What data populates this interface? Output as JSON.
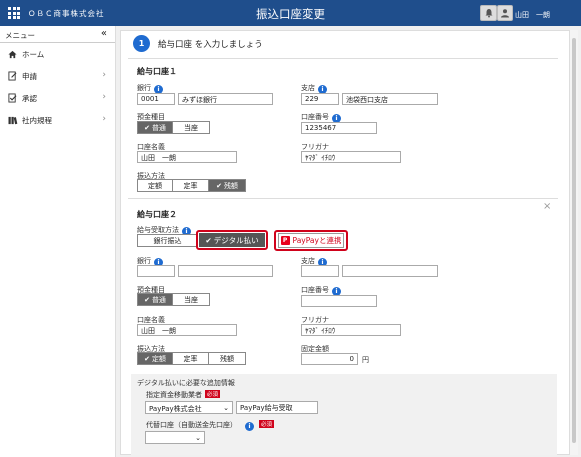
{
  "topbar": {
    "company": "ＯＢＣ商事株式会社",
    "title": "振込口座変更",
    "username": "山田　一朗"
  },
  "sidebar": {
    "header": "メニュー",
    "collapse": "«",
    "items": [
      {
        "label": "ホーム",
        "icon": "home-icon",
        "chevron": false
      },
      {
        "label": "申請",
        "icon": "application-icon",
        "chevron": true
      },
      {
        "label": "承認",
        "icon": "approval-icon",
        "chevron": true
      },
      {
        "label": "社内規程",
        "icon": "books-icon",
        "chevron": true
      }
    ]
  },
  "step": {
    "number": "1",
    "title": "給与口座 を入力しましょう"
  },
  "account1": {
    "title": "給与口座１",
    "bank_label": "銀行",
    "bank_code": "0001",
    "bank_name": "みずほ銀行",
    "branch_label": "支店",
    "branch_code": "229",
    "branch_name": "池袋西口支店",
    "type_label": "預金種目",
    "type_options": [
      "普通",
      "当座"
    ],
    "type_selected": "普通",
    "number_label": "口座番号",
    "number_value": "1235467",
    "holder_label": "口座名義",
    "holder_value": "山田　一朗",
    "kana_label": "フリガナ",
    "kana_value": "ﾔﾏﾀﾞ ｲﾁﾛｳ",
    "method_label": "振込方法",
    "method_options": [
      "定額",
      "定率",
      "残額"
    ],
    "method_selected": "残額"
  },
  "account2": {
    "title": "給与口座２",
    "close": "×",
    "receive_label": "給与受取方法",
    "receive_bank": "銀行振込",
    "receive_digital": "デジタル払い",
    "paypay_button": "PayPayと連携",
    "paypay_logo": "P",
    "bank_label": "銀行",
    "bank_code": "",
    "bank_name": "",
    "branch_label": "支店",
    "branch_code": "",
    "branch_name": "",
    "type_label": "預金種目",
    "type_options": [
      "普通",
      "当座"
    ],
    "type_selected": "普通",
    "number_label": "口座番号",
    "number_value": "",
    "holder_label": "口座名義",
    "holder_value": "山田　一朗",
    "kana_label": "フリガナ",
    "kana_value": "ﾔﾏﾀﾞ ｲﾁﾛｳ",
    "method_label": "振込方法",
    "method_options": [
      "定額",
      "定率",
      "残額"
    ],
    "method_selected": "定額",
    "fixed_label": "固定金額",
    "fixed_value": "0",
    "fixed_unit": "円"
  },
  "digital": {
    "title": "デジタル払いに必要な追加情報",
    "provider_label": "指定資金移動業者",
    "required": "必須",
    "provider_value": "PayPay株式会社",
    "provider_name": "PayPay給与受取",
    "backup_label": "代替口座（自動送金先口座）",
    "backup_value": ""
  },
  "colors": {
    "header": "#1f4e8c",
    "accent": "#1f6bd0",
    "highlight": "#d0021b",
    "selected": "#666666"
  },
  "icons": {
    "check": "✔",
    "info": "i",
    "chevron": "›",
    "caret": "⌄"
  }
}
